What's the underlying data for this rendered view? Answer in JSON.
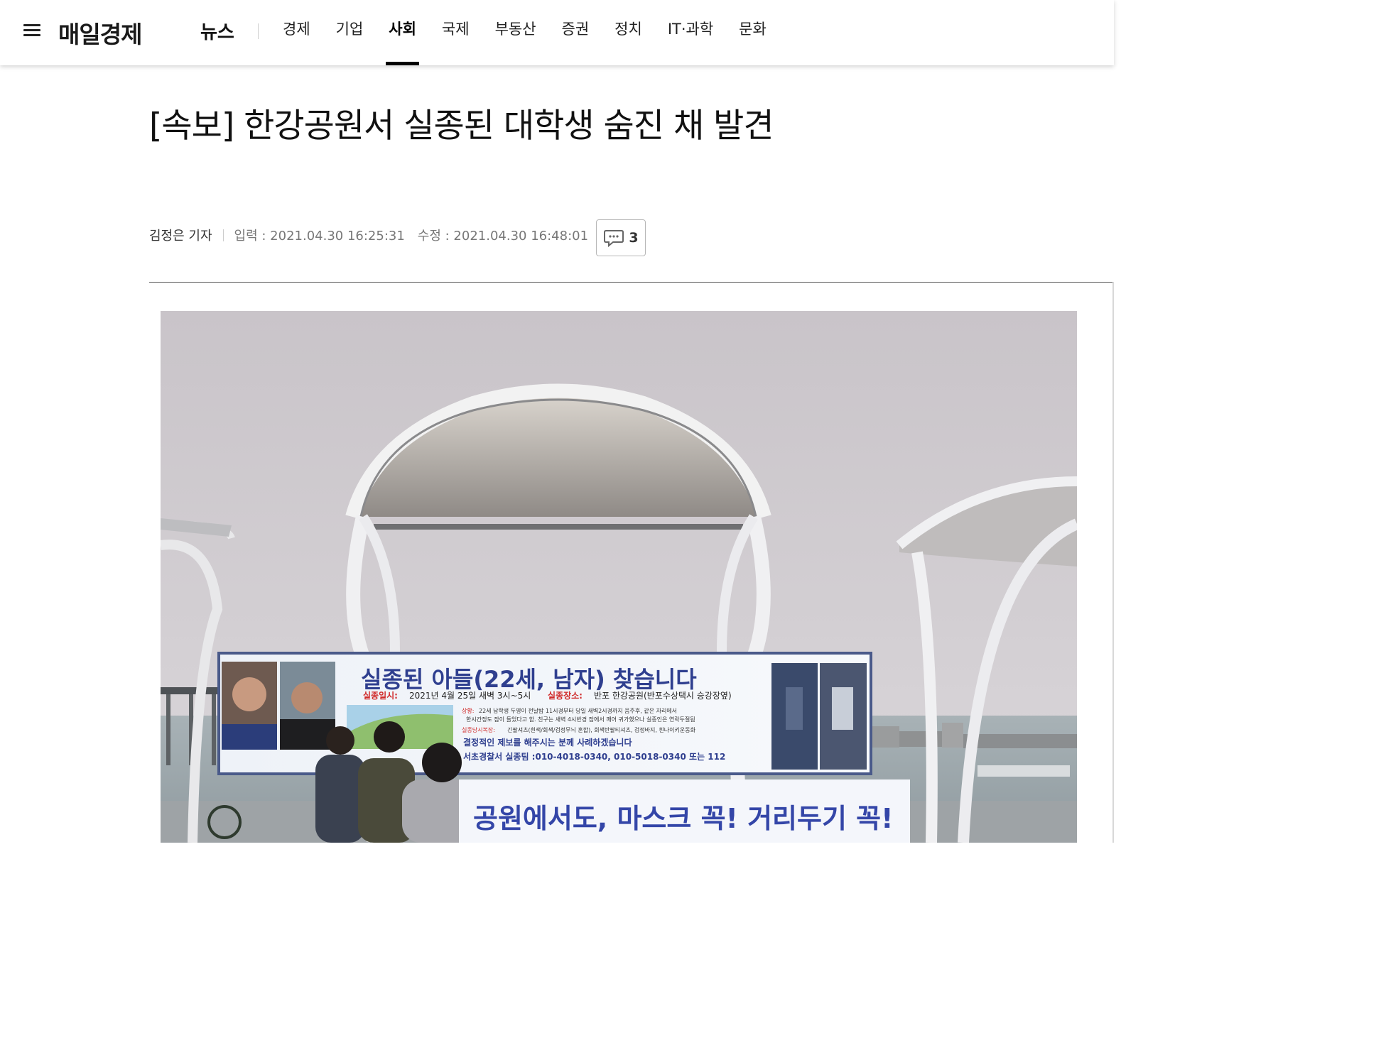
{
  "header": {
    "logo": "매일경제",
    "section": "뉴스",
    "menu": [
      {
        "label": "경제",
        "active": false
      },
      {
        "label": "기업",
        "active": false
      },
      {
        "label": "사회",
        "active": true
      },
      {
        "label": "국제",
        "active": false
      },
      {
        "label": "부동산",
        "active": false
      },
      {
        "label": "증권",
        "active": false
      },
      {
        "label": "정치",
        "active": false
      },
      {
        "label": "IT·과학",
        "active": false
      },
      {
        "label": "문화",
        "active": false
      }
    ]
  },
  "article": {
    "headline": "[속보] 한강공원서 실종된 대학생 숨진 채 발견",
    "author": "김정은 기자",
    "published": "입력 : 2021.04.30 16:25:31",
    "modified": "수정 : 2021.04.30 16:48:01",
    "comment_count": "3"
  },
  "photo": {
    "banner_title": "실종된 아들(22세, 남자) 찾습니다",
    "banner_date_label": "실종일시:",
    "banner_date": "2021년 4월 25일 새벽 3시~5시",
    "banner_place_label": "실종장소:",
    "banner_place": "반포 한강공원(반포수상택시 승강장옆)",
    "banner_situation_label": "상황:",
    "banner_situation_1": "22세 남학생 두명이 전날밤 11시경부터 당일 새벽2시경까지 음주후, 같은 자리에서",
    "banner_situation_2": "한시간정도 잠이 들었다고 함. 친구는 새벽 4시반경 잠에서 깨어 귀가했으나 실종인은 연락두절됨",
    "banner_clothes_label": "실종당시복장:",
    "banner_clothes": "긴팔셔츠(흰색/회색/검정무늬 혼합), 회색반팔티셔츠, 검정바지, 흰나이키운동화",
    "banner_reward": "결정적인 제보를 해주시는 분께 사례하겠습니다",
    "banner_contact": "서초경찰서 실종팀 :010-4018-0340, 010-5018-0340 또는 112",
    "sign_text": "공원에서도, 마스크 꼭! 거리두기 꼭!"
  }
}
